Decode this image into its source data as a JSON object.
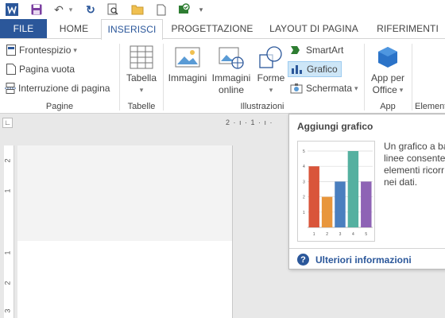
{
  "qat": {
    "icons": [
      "word-logo-icon",
      "save-icon",
      "undo-icon",
      "redo-icon",
      "print-preview-icon",
      "open-folder-icon",
      "new-document-icon",
      "customize-icon",
      "dropdown-icon"
    ],
    "undo_arrow": "↶",
    "redo_arrow": "↻",
    "more_arrow": "▾"
  },
  "tabs": [
    {
      "label": "FILE"
    },
    {
      "label": "HOME"
    },
    {
      "label": "INSERISCI"
    },
    {
      "label": "PROGETTAZIONE"
    },
    {
      "label": "LAYOUT DI PAGINA"
    },
    {
      "label": "RIFERIMENTI"
    }
  ],
  "ribbon": {
    "pagine": {
      "label": "Pagine",
      "frontespizio": "Frontespizio",
      "pagina_vuota": "Pagina vuota",
      "interruzione": "Interruzione di pagina"
    },
    "tabelle": {
      "label": "Tabelle",
      "tabella": "Tabella"
    },
    "illustrazioni": {
      "label": "Illustrazioni",
      "immagini": "Immagini",
      "immagini_online_1": "Immagini",
      "immagini_online_2": "online",
      "forme": "Forme",
      "smartart": "SmartArt",
      "grafico": "Grafico",
      "schermata": "Schermata"
    },
    "app": {
      "label": "App",
      "app_per_1": "App per",
      "app_per_2": "Office"
    },
    "elementi": {
      "label": "Elementi"
    },
    "dropdown_arrow": "▾"
  },
  "ruler": {
    "h_text": "2 · ı · 1 · ı ·",
    "v_marks": [
      "2",
      "1",
      "1",
      "2",
      "3"
    ]
  },
  "tooltip": {
    "title": "Aggiungi grafico",
    "desc": [
      "Un grafico a ba",
      "linee consente",
      "elementi ricorr",
      "nei dati."
    ],
    "link": "Ulteriori informazioni",
    "help_glyph": "?"
  },
  "chart_data": {
    "type": "bar",
    "categories": [
      "1",
      "2",
      "3",
      "4",
      "5"
    ],
    "values": [
      4,
      2,
      3,
      5,
      3
    ],
    "ylim": [
      0,
      5
    ],
    "yticks": [
      "1",
      "2",
      "3",
      "4",
      "5"
    ],
    "colors": [
      "#d9553a",
      "#e8963c",
      "#4a7fbf",
      "#55b0a0",
      "#8e63b5"
    ]
  }
}
